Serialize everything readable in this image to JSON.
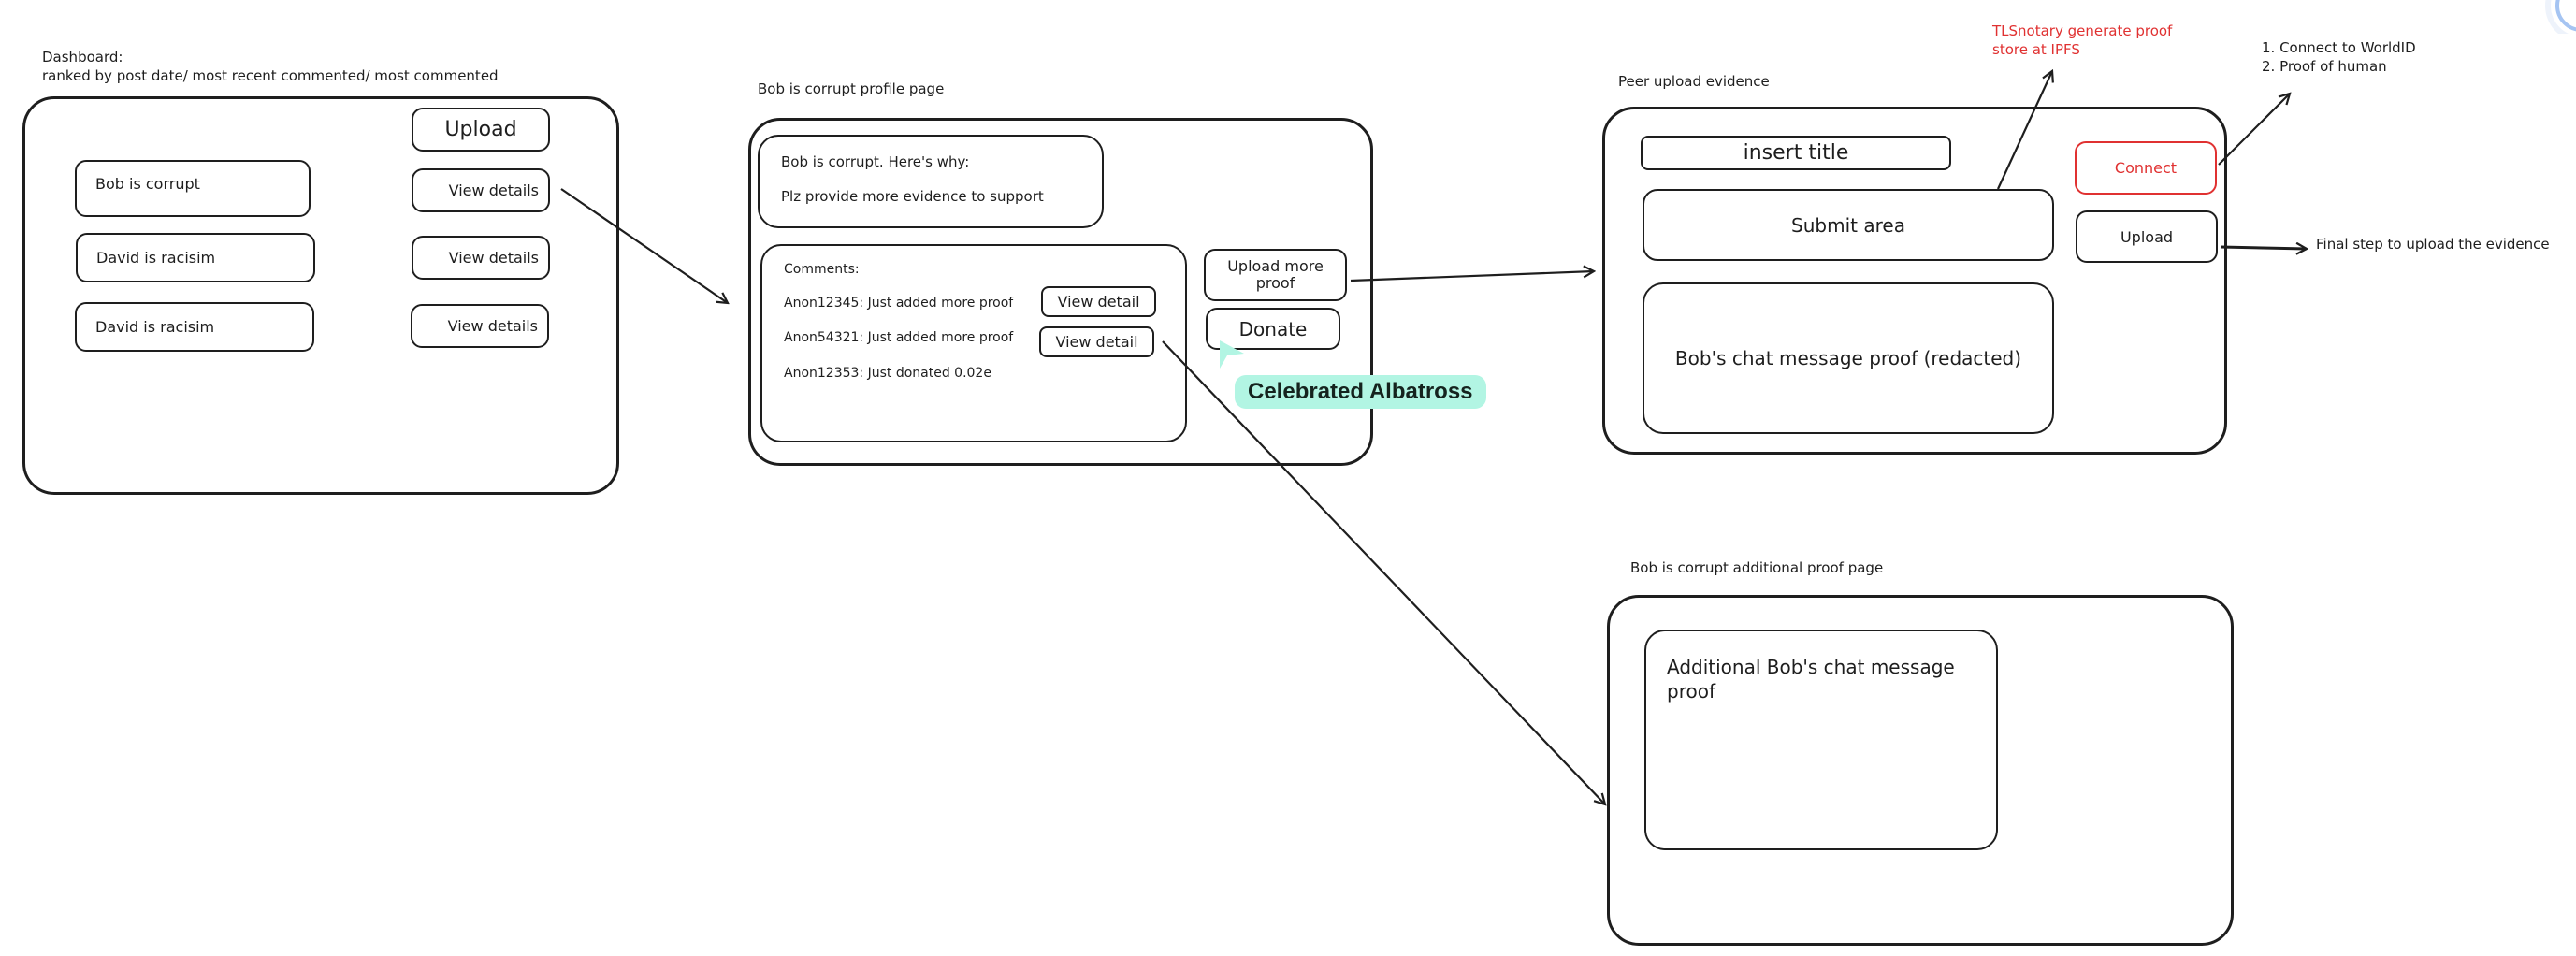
{
  "dashboard": {
    "title": "Dashboard:",
    "subtitle": "ranked by post date/ most recent commented/ most commented",
    "upload_label": "Upload",
    "posts": [
      {
        "title": "Bob is corrupt",
        "action": "View details"
      },
      {
        "title": "David is racisim",
        "action": "View details"
      },
      {
        "title": "David is racisim",
        "action": "View details"
      }
    ]
  },
  "profile": {
    "title": "Bob is corrupt profile page",
    "summary_line1": "Bob is corrupt. Here's why:",
    "summary_line2": "Plz provide more evidence to support",
    "comments_heading": "Comments:",
    "comments": [
      {
        "text": "Anon12345: Just added more proof",
        "action": "View detail"
      },
      {
        "text": "Anon54321: Just added more proof",
        "action": "View detail"
      },
      {
        "text": "Anon12353: Just donated 0.02e",
        "action": null
      }
    ],
    "upload_more_label": "Upload more proof",
    "donate_label": "Donate"
  },
  "peer_upload": {
    "title": "Peer upload evidence",
    "title_input_placeholder": "insert title",
    "submit_area_label": "Submit area",
    "proof_label": "Bob's chat message proof (redacted)",
    "connect_label": "Connect",
    "upload_label": "Upload"
  },
  "annotations": {
    "tlsnotary": "TLSnotary generate proof\nstore at IPFS",
    "tlsnotary_line1": "TLSnotary generate proof",
    "tlsnotary_line2": "store at IPFS",
    "worldid_line1": "1. Connect to WorldID",
    "worldid_line2": "2. Proof of human",
    "final_step": "Final step to upload the evidence"
  },
  "additional_proof": {
    "title": "Bob is corrupt additional proof page",
    "content": "Additional Bob's chat message proof"
  },
  "collaborator": {
    "name": "Celebrated Albatross",
    "color": "#b2f5e3"
  },
  "colors": {
    "stroke": "#1e1e1e",
    "accent_red": "#e03131"
  }
}
